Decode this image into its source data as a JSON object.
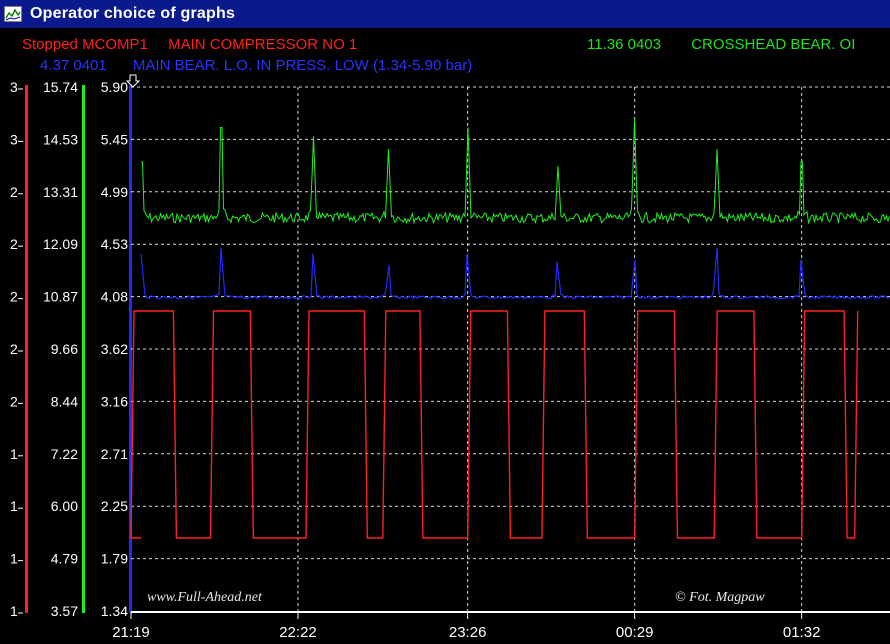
{
  "window": {
    "title": "Operator choice of graphs"
  },
  "header": {
    "line1_left": {
      "status": "Stopped",
      "tag": "MCOMP1",
      "desc": "MAIN COMPRESSOR NO 1"
    },
    "line1_right": {
      "value": "11.36",
      "tag": "0403",
      "desc": "CROSSHEAD BEAR. OI"
    },
    "line2": {
      "value": "4.37",
      "tag": "0401",
      "desc": "MAIN BEAR. L.O. IN PRESS. LOW  (1.34-5.90 bar)"
    }
  },
  "axes": {
    "red_scale": [
      "3",
      "3",
      "2",
      "2",
      "2",
      "2",
      "2",
      "1",
      "1",
      "1",
      "1"
    ],
    "green_scale": [
      "15.74",
      "14.53",
      "13.31",
      "12.09",
      "10.87",
      "9.66",
      "8.44",
      "7.22",
      "6.00",
      "4.79",
      "3.57"
    ],
    "blue_scale": [
      "5.90",
      "5.45",
      "4.99",
      "4.53",
      "4.08",
      "3.62",
      "3.16",
      "2.71",
      "2.25",
      "1.79",
      "1.34"
    ],
    "time_labels": [
      "21:19",
      "22:22",
      "23:26",
      "00:29",
      "01:32"
    ],
    "cursor_icon": "down-arrow-icon"
  },
  "watermarks": {
    "left": "www.Full-Ahead.net",
    "right": "© Fot. Magpaw"
  },
  "colors": {
    "red": "#ff2020",
    "green": "#22ee22",
    "blue": "#1f2cff",
    "titlebar": "#0a1a8c",
    "grid": "#ffffff"
  },
  "chart_data": {
    "type": "line",
    "x_start": "21:19",
    "x_ticks": [
      "21:19",
      "22:22",
      "23:26",
      "00:29",
      "01:32"
    ],
    "series": [
      {
        "name": "CROSSHEAD BEAR. OI",
        "color": "#22ee22",
        "ylim": [
          3.57,
          15.74
        ],
        "baseline": 12.7,
        "spikes": [
          {
            "t": "21:23",
            "value": 14.0
          },
          {
            "t": "21:53",
            "value": 14.8
          },
          {
            "t": "22:28",
            "value": 14.6
          },
          {
            "t": "22:56",
            "value": 14.3
          },
          {
            "t": "23:26",
            "value": 14.8
          },
          {
            "t": "00:00",
            "value": 13.9
          },
          {
            "t": "00:29",
            "value": 15.0
          },
          {
            "t": "01:00",
            "value": 14.3
          },
          {
            "t": "01:32",
            "value": 14.0
          }
        ]
      },
      {
        "name": "MAIN BEAR. L.O. IN PRESS. LOW",
        "color": "#1f2cff",
        "ylim": [
          1.34,
          5.9
        ],
        "baseline": 4.07,
        "spikes": [
          {
            "t": "21:23",
            "value": 4.45
          },
          {
            "t": "21:53",
            "value": 4.5
          },
          {
            "t": "22:28",
            "value": 4.45
          },
          {
            "t": "22:56",
            "value": 4.35
          },
          {
            "t": "23:26",
            "value": 4.45
          },
          {
            "t": "00:00",
            "value": 4.38
          },
          {
            "t": "00:29",
            "value": 4.4
          },
          {
            "t": "01:00",
            "value": 4.5
          },
          {
            "t": "01:32",
            "value": 4.4
          }
        ]
      },
      {
        "name": "Stopped MCOMP1",
        "color": "#ff2020",
        "ylim": [
          1,
          3
        ],
        "states": [
          "Stopped",
          "Running"
        ],
        "transitions": [
          "21:19",
          "21:35",
          "21:49",
          "22:04",
          "22:25",
          "22:47",
          "22:54",
          "23:08",
          "23:26",
          "23:41",
          "23:54",
          "00:10",
          "00:29",
          "00:44",
          "00:59",
          "01:14",
          "01:32",
          "01:48",
          "01:52"
        ]
      }
    ],
    "grid": true,
    "legend": "top"
  }
}
